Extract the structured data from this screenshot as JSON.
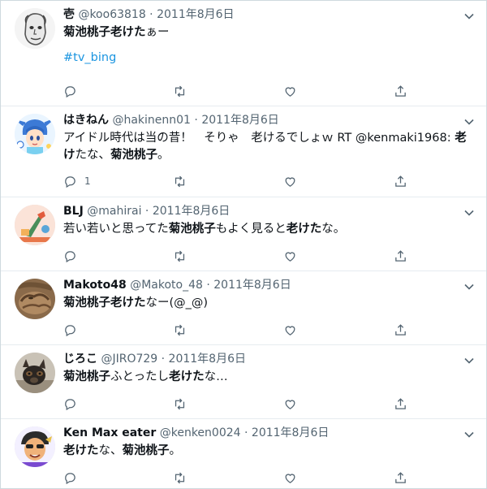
{
  "colors": {
    "accent": "#1b95e0",
    "muted": "#536471",
    "border": "#e6ecf0"
  },
  "icons": [
    "reply-icon",
    "retweet-icon",
    "like-icon",
    "share-icon",
    "caret-down-icon"
  ],
  "tweets": [
    {
      "name": "壱",
      "handle": "@koo63818",
      "sep": " · ",
      "date": "2011年8月6日",
      "text": [
        {
          "t": "菊池桃子老けた",
          "b": true
        },
        {
          "t": "ぁー",
          "b": false
        }
      ],
      "hashtag": "#tv_bing",
      "reply_count": ""
    },
    {
      "name": "はきねん",
      "handle": "@hakinenn01",
      "sep": " · ",
      "date": "2011年8月6日",
      "text": [
        {
          "t": "アイドル時代は当の昔！　そりゃ　老けるでしょｗ RT @kenmaki1968: ",
          "b": false
        },
        {
          "t": "老け",
          "b": true
        },
        {
          "t": "たな、",
          "b": false
        },
        {
          "t": "菊池桃子",
          "b": true
        },
        {
          "t": "。",
          "b": false
        }
      ],
      "hashtag": "",
      "reply_count": "1"
    },
    {
      "name": "BLJ",
      "handle": "@mahirai",
      "sep": " · ",
      "date": "2011年8月6日",
      "text": [
        {
          "t": "若い若いと思ってた",
          "b": false
        },
        {
          "t": "菊池桃子",
          "b": true
        },
        {
          "t": "もよく見ると",
          "b": false
        },
        {
          "t": "老けた",
          "b": true
        },
        {
          "t": "な。",
          "b": false
        }
      ],
      "hashtag": "",
      "reply_count": ""
    },
    {
      "name": "Makoto48",
      "handle": "@Makoto_48",
      "sep": " · ",
      "date": "2011年8月6日",
      "text": [
        {
          "t": "菊池桃子老けた",
          "b": true
        },
        {
          "t": "なー(@_@)",
          "b": false
        }
      ],
      "hashtag": "",
      "reply_count": ""
    },
    {
      "name": "じろこ",
      "handle": "@JIRO729",
      "sep": " · ",
      "date": "2011年8月6日",
      "text": [
        {
          "t": "菊池桃子",
          "b": true
        },
        {
          "t": "ふとったし",
          "b": false
        },
        {
          "t": "老けた",
          "b": true
        },
        {
          "t": "な…",
          "b": false
        }
      ],
      "hashtag": "",
      "reply_count": ""
    },
    {
      "name": "Ken Max eater",
      "handle": "@kenken0024",
      "sep": " · ",
      "date": "2011年8月6日",
      "text": [
        {
          "t": "老けた",
          "b": true
        },
        {
          "t": "な、",
          "b": false
        },
        {
          "t": "菊池桃子",
          "b": true
        },
        {
          "t": "。",
          "b": false
        }
      ],
      "hashtag": "",
      "reply_count": ""
    }
  ]
}
